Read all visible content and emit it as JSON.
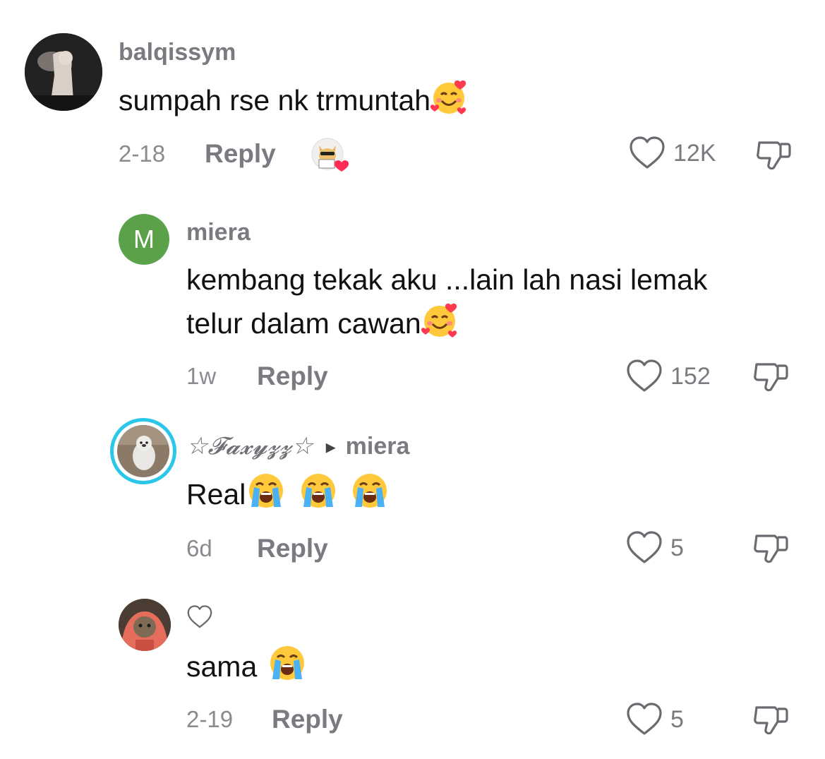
{
  "comments": [
    {
      "username": "balqissym",
      "text": "sumpah rse nk trmuntah",
      "emoji": "smiling-face-with-hearts",
      "date": "2-18",
      "reply": "Reply",
      "likes": "12K"
    },
    {
      "avatar_letter": "M",
      "avatar_color": "#5aa14a",
      "username": "miera",
      "text_line1": "kembang tekak aku ...lain lah nasi lemak",
      "text_line2": "telur dalam cawan",
      "emoji": "smiling-face-with-hearts",
      "date": "1w",
      "reply": "Reply",
      "likes": "152"
    },
    {
      "username": "☆𝓕𝓪𝔁𝔂𝔃𝔃☆",
      "reply_to_arrow": "▸",
      "reply_to": "miera",
      "text": "Real",
      "emoji": "loudly-crying-face",
      "date": "6d",
      "reply": "Reply",
      "likes": "5"
    },
    {
      "text": "sama",
      "emoji": "loudly-crying-face",
      "date": "2-19",
      "reply": "Reply",
      "likes": "5"
    }
  ],
  "colors": {
    "accent_ring": "#2bc7e8",
    "muted_text": "#7a7a80"
  }
}
